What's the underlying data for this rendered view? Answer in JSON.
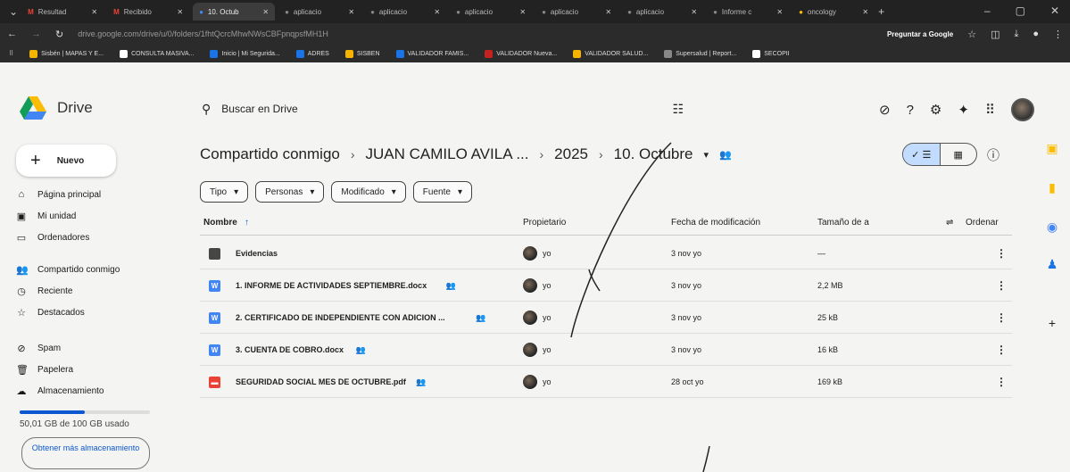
{
  "browser": {
    "tabs": [
      {
        "label": "Resultad",
        "icon": "gmail-icon",
        "active": false
      },
      {
        "label": "Recibido",
        "icon": "gmail-icon",
        "active": false
      },
      {
        "label": "10. Octub",
        "icon": "drive-icon",
        "active": true
      },
      {
        "label": "aplicacio",
        "icon": "page-icon",
        "active": false
      },
      {
        "label": "aplicacio",
        "icon": "page-icon",
        "active": false
      },
      {
        "label": "aplicacio",
        "icon": "page-icon",
        "active": false
      },
      {
        "label": "aplicacio",
        "icon": "page-icon",
        "active": false
      },
      {
        "label": "aplicacio",
        "icon": "page-icon",
        "active": false
      },
      {
        "label": "Informe c",
        "icon": "page-icon",
        "active": false
      },
      {
        "label": "oncology",
        "icon": "google-icon",
        "active": false
      }
    ],
    "url": "drive.google.com/drive/u/0/folders/1fhtQcrcMhwNWsCBFpnqpsfMH1H",
    "ask_google": "Preguntar a Google",
    "bookmarks": [
      {
        "label": "Sisbén | MAPAS Y E...",
        "color": "#f4b400"
      },
      {
        "label": "CONSULTA MASIVA...",
        "color": "#ffffff"
      },
      {
        "label": "Inicio | Mi Segurida...",
        "color": "#1a73e8"
      },
      {
        "label": "ADRES",
        "color": "#1a73e8"
      },
      {
        "label": "SISBEN",
        "color": "#f4b400"
      },
      {
        "label": "VALIDADOR FAMIS...",
        "color": "#1a73e8"
      },
      {
        "label": "VALIDADOR Nueva...",
        "color": "#c5221f"
      },
      {
        "label": "VALIDADOR SALUD...",
        "color": "#f4b400"
      },
      {
        "label": "Supersalud | Report...",
        "color": "#888888"
      },
      {
        "label": "SECOPII",
        "color": "#ffffff"
      }
    ]
  },
  "drive": {
    "title": "Drive",
    "search_placeholder": "Buscar en Drive",
    "new_label": "Nuevo",
    "nav": [
      {
        "label": "Página principal",
        "icon": "home-icon",
        "glyph": "⌂"
      },
      {
        "label": "Mi unidad",
        "icon": "my-drive-icon",
        "glyph": "▣"
      },
      {
        "label": "Ordenadores",
        "icon": "computer-icon",
        "glyph": "▭"
      },
      {
        "label": "Compartido conmigo",
        "icon": "shared-icon",
        "glyph": "👥"
      },
      {
        "label": "Reciente",
        "icon": "clock-icon",
        "glyph": "◷"
      },
      {
        "label": "Destacados",
        "icon": "star-icon",
        "glyph": "☆"
      },
      {
        "label": "Spam",
        "icon": "spam-icon",
        "glyph": "⊘"
      },
      {
        "label": "Papelera",
        "icon": "trash-icon",
        "glyph": "🗑"
      },
      {
        "label": "Almacenamiento",
        "icon": "cloud-icon",
        "glyph": "☁"
      }
    ],
    "storage": {
      "text": "50,01 GB de 100 GB usado",
      "fraction": 0.5001
    },
    "get_more": "Obtener más almacenamiento",
    "breadcrumb": [
      "Compartido conmigo",
      "JUAN CAMILO AVILA ...",
      "2025",
      "10. Octubre"
    ],
    "filters": [
      "Tipo",
      "Personas",
      "Modificado",
      "Fuente"
    ],
    "columns": {
      "name": "Nombre",
      "owner": "Propietario",
      "modified": "Fecha de modificación",
      "size": "Tamaño de a",
      "sort": "Ordenar"
    },
    "files": [
      {
        "name": "Evidencias",
        "type": "folder",
        "shared": false,
        "owner": "yo",
        "modified": "3 nov yo",
        "size": "—"
      },
      {
        "name": "1. INFORME DE ACTIVIDADES SEPTIEMBRE.docx",
        "type": "docx",
        "shared": true,
        "owner": "yo",
        "modified": "3 nov yo",
        "size": "2,2 MB"
      },
      {
        "name": "2. CERTIFICADO DE INDEPENDIENTE CON ADICION ...",
        "type": "docx",
        "shared": true,
        "owner": "yo",
        "modified": "3 nov yo",
        "size": "25 kB"
      },
      {
        "name": "3. CUENTA DE COBRO.docx",
        "type": "docx",
        "shared": true,
        "owner": "yo",
        "modified": "3 nov yo",
        "size": "16 kB"
      },
      {
        "name": "SEGURIDAD SOCIAL MES DE OCTUBRE.pdf",
        "type": "pdf",
        "shared": true,
        "owner": "yo",
        "modified": "28 oct yo",
        "size": "169 kB"
      }
    ],
    "colors": {
      "accent": "#0b57d0",
      "docx": "#4285f4",
      "pdf": "#ea4335",
      "folder": "#444746",
      "toggle_on": "#c2dcff"
    }
  }
}
